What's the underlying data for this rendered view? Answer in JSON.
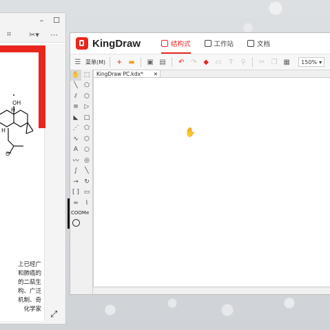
{
  "left_window": {
    "title_controls": [
      "–",
      "☐"
    ],
    "toolbar": [
      "⌗",
      "✂▾",
      "⋯"
    ],
    "chem_labels": {
      "oh": "OH",
      "h1": "H",
      "h2": "H",
      "o": "O"
    },
    "text_lines": [
      "上已经广",
      "和肺癌的",
      "的二萜生",
      "构、广泛",
      "机制、奇",
      "化学家"
    ],
    "expand_icon": "⤢"
  },
  "kingdraw": {
    "app_name": "KingDraw",
    "tabs": [
      {
        "label": "结构式",
        "active": true
      },
      {
        "label": "工作站",
        "active": false
      },
      {
        "label": "文档",
        "active": false
      }
    ],
    "menu_label": "菜单(M)",
    "zoom": "150%",
    "doc_tab": {
      "label": "KingDraw PC.kdx*",
      "close": "✕"
    },
    "palette_text": [
      "A",
      "COOMe"
    ]
  },
  "colors": {
    "accent": "#e8261d"
  }
}
